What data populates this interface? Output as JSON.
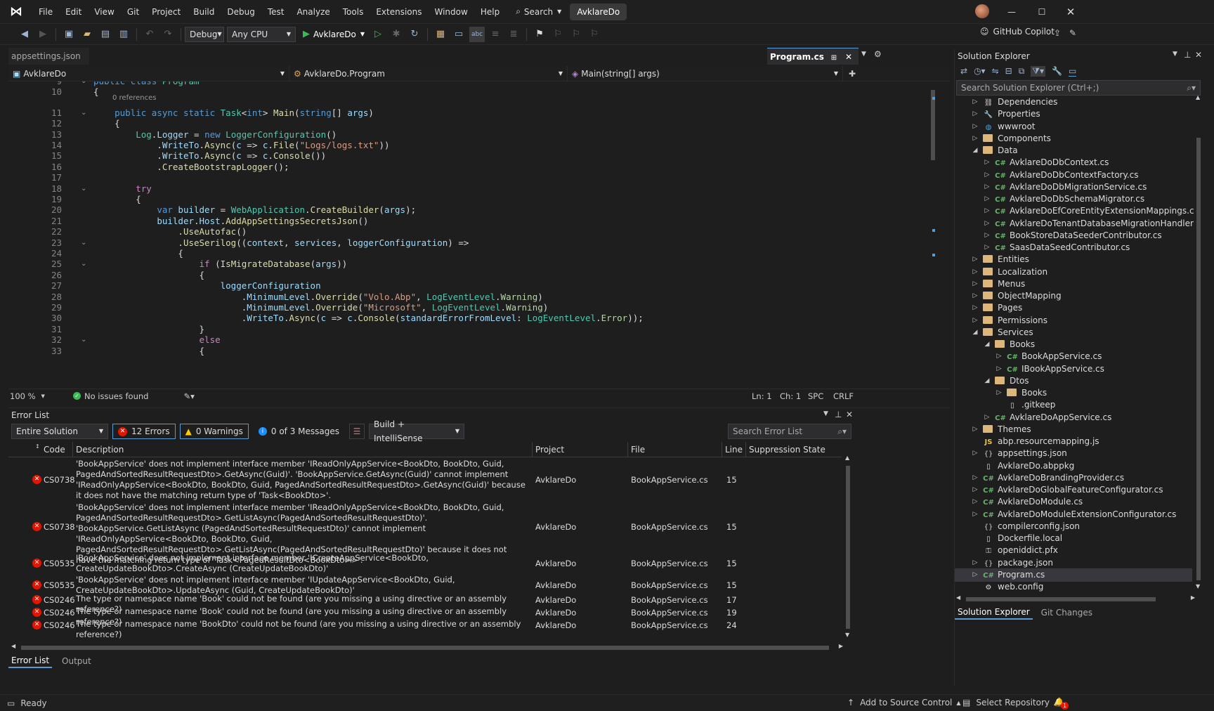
{
  "titlebar": {
    "menus": [
      "File",
      "Edit",
      "View",
      "Git",
      "Project",
      "Build",
      "Debug",
      "Test",
      "Analyze",
      "Tools",
      "Extensions",
      "Window",
      "Help"
    ],
    "search_label": "Search",
    "solution_name": "AvklareDo"
  },
  "toolbar": {
    "config": "Debug",
    "platform": "Any CPU",
    "run_target": "AvklareDo",
    "copilot_label": "GitHub Copilot"
  },
  "editor": {
    "preview_tab": "appsettings.json",
    "active_tab": "Program.cs",
    "nav_project": "AvklareDo",
    "nav_type": "AvklareDo.Program",
    "nav_member": "Main(string[] args)",
    "codelens": "0 references",
    "zoom": "100 %",
    "issues": "No issues found",
    "ln": "Ln: 1",
    "ch": "Ch: 1",
    "spc": "SPC",
    "eol": "CRLF",
    "lines": [
      {
        "n": "9",
        "html": "<span class='kw'>public</span> <span class='kw'>class</span> <span class='ty'>Program</span>"
      },
      {
        "n": "10",
        "html": "{"
      },
      {
        "n": "11",
        "html": "    <span class='kw'>public</span> <span class='kw'>async</span> <span class='kw'>static</span> <span class='ty'>Task</span>&lt;<span class='kw'>int</span>&gt; <span class='fn'>Main</span>(<span class='kw'>string</span>[] <span class='pa'>args</span>)"
      },
      {
        "n": "12",
        "html": "    {"
      },
      {
        "n": "13",
        "html": "        <span class='ty'>Log</span>.<span class='pa'>Logger</span> = <span class='kw'>new</span> <span class='ty'>LoggerConfiguration</span>()"
      },
      {
        "n": "14",
        "html": "            .<span class='pa'>WriteTo</span>.<span class='fn'>Async</span>(<span class='pa'>c</span> =&gt; <span class='pa'>c</span>.<span class='fn'>File</span>(<span class='st'>\"Logs/logs.txt\"</span>))"
      },
      {
        "n": "15",
        "html": "            .<span class='pa'>WriteTo</span>.<span class='fn'>Async</span>(<span class='pa'>c</span> =&gt; <span class='pa'>c</span>.<span class='fn'>Console</span>())"
      },
      {
        "n": "16",
        "html": "            .<span class='fn'>CreateBootstrapLogger</span>();"
      },
      {
        "n": "17",
        "html": ""
      },
      {
        "n": "18",
        "html": "        <span class='ct'>try</span>"
      },
      {
        "n": "19",
        "html": "        {"
      },
      {
        "n": "20",
        "html": "            <span class='kw'>var</span> <span class='pa'>builder</span> = <span class='ty'>WebApplication</span>.<span class='fn'>CreateBuilder</span>(<span class='pa'>args</span>);"
      },
      {
        "n": "21",
        "html": "            <span class='pa'>builder</span>.<span class='pa'>Host</span>.<span class='fn'>AddAppSettingsSecretsJson</span>()"
      },
      {
        "n": "22",
        "html": "                .<span class='fn'>UseAutofac</span>()"
      },
      {
        "n": "23",
        "html": "                .<span class='fn'>UseSerilog</span>((<span class='pa'>context</span>, <span class='pa'>services</span>, <span class='pa'>loggerConfiguration</span>) =&gt;"
      },
      {
        "n": "24",
        "html": "                {"
      },
      {
        "n": "25",
        "html": "                    <span class='ct'>if</span> (<span class='fn'>IsMigrateDatabase</span>(<span class='pa'>args</span>))"
      },
      {
        "n": "26",
        "html": "                    {"
      },
      {
        "n": "27",
        "html": "                        <span class='pa'>loggerConfiguration</span>"
      },
      {
        "n": "28",
        "html": "                            .<span class='pa'>MinimumLevel</span>.<span class='fn'>Override</span>(<span class='st'>\"Volo.Abp\"</span>, <span class='ty'>LogEventLevel</span>.<span class='en'>Warning</span>)"
      },
      {
        "n": "29",
        "html": "                            .<span class='pa'>MinimumLevel</span>.<span class='fn'>Override</span>(<span class='st'>\"Microsoft\"</span>, <span class='ty'>LogEventLevel</span>.<span class='en'>Warning</span>)"
      },
      {
        "n": "30",
        "html": "                            .<span class='pa'>WriteTo</span>.<span class='fn'>Async</span>(<span class='pa'>c</span> =&gt; <span class='pa'>c</span>.<span class='fn'>Console</span>(<span class='pa'>standardErrorFromLevel</span>: <span class='ty'>LogEventLevel</span>.<span class='en'>Error</span>));"
      },
      {
        "n": "31",
        "html": "                    }"
      },
      {
        "n": "32",
        "html": "                    <span class='ct'>else</span>"
      },
      {
        "n": "33",
        "html": "                    {"
      }
    ]
  },
  "errorlist": {
    "title": "Error List",
    "scope": "Entire Solution",
    "errors_btn": "12 Errors",
    "warnings_btn": "0 Warnings",
    "messages_btn": "0 of 3 Messages",
    "source": "Build + IntelliSense",
    "search_placeholder": "Search Error List",
    "columns": {
      "code": "Code",
      "description": "Description",
      "project": "Project",
      "file": "File",
      "line": "Line",
      "suppression": "Suppression State"
    },
    "rows": [
      {
        "code": "CS0738",
        "desc": "'BookAppService' does not implement interface member 'IReadOnlyAppService<BookDto, BookDto, Guid, PagedAndSortedResultRequestDto>.GetAsync(Guid)'. 'BookAppService.GetAsync(Guid)' cannot implement 'IReadOnlyAppService<BookDto, BookDto, Guid, PagedAndSortedResultRequestDto>.GetAsync(Guid)' because it does not have the matching return type of 'Task<BookDto>'.",
        "project": "AvklareDo",
        "file": "BookAppService.cs",
        "line": "15"
      },
      {
        "code": "CS0738",
        "desc": "'BookAppService' does not implement interface member 'IReadOnlyAppService<BookDto, BookDto, Guid, PagedAndSortedResultRequestDto>.GetListAsync(PagedAndSortedResultRequestDto)'. 'BookAppService.GetListAsync (PagedAndSortedResultRequestDto)' cannot implement 'IReadOnlyAppService<BookDto, BookDto, Guid, PagedAndSortedResultRequestDto>.GetListAsync(PagedAndSortedResultRequestDto)' because it does not have the matching return type of 'Task<PagedResultDto<BookDto>>'.",
        "project": "AvklareDo",
        "file": "BookAppService.cs",
        "line": "15"
      },
      {
        "code": "CS0535",
        "desc": "'BookAppService' does not implement interface member 'ICreateAppService<BookDto, CreateUpdateBookDto>.CreateAsync (CreateUpdateBookDto)'",
        "project": "AvklareDo",
        "file": "BookAppService.cs",
        "line": "15"
      },
      {
        "code": "CS0535",
        "desc": "'BookAppService' does not implement interface member 'IUpdateAppService<BookDto, Guid, CreateUpdateBookDto>.UpdateAsync (Guid, CreateUpdateBookDto)'",
        "project": "AvklareDo",
        "file": "BookAppService.cs",
        "line": "15"
      },
      {
        "code": "CS0246",
        "desc": "The type or namespace name 'Book' could not be found (are you missing a using directive or an assembly reference?)",
        "project": "AvklareDo",
        "file": "BookAppService.cs",
        "line": "17"
      },
      {
        "code": "CS0246",
        "desc": "The type or namespace name 'Book' could not be found (are you missing a using directive or an assembly reference?)",
        "project": "AvklareDo",
        "file": "BookAppService.cs",
        "line": "19"
      },
      {
        "code": "CS0246",
        "desc": "The type or namespace name 'BookDto' could not be found (are you missing a using directive or an assembly reference?)",
        "project": "AvklareDo",
        "file": "BookAppService.cs",
        "line": "24"
      }
    ],
    "bottom_tabs": [
      "Error List",
      "Output"
    ]
  },
  "solution_explorer": {
    "title": "Solution Explorer",
    "search_placeholder": "Search Solution Explorer (Ctrl+;)",
    "items": [
      {
        "label": "Dependencies",
        "depth": 0,
        "icon": "deps",
        "arrow": "right"
      },
      {
        "label": "Properties",
        "depth": 0,
        "icon": "wrench",
        "arrow": "right"
      },
      {
        "label": "wwwroot",
        "depth": 0,
        "icon": "globe",
        "arrow": "right"
      },
      {
        "label": "Components",
        "depth": 0,
        "icon": "folder",
        "arrow": "right"
      },
      {
        "label": "Data",
        "depth": 0,
        "icon": "folder",
        "arrow": "down"
      },
      {
        "label": "AvklareDoDbContext.cs",
        "depth": 1,
        "icon": "cs",
        "arrow": "right"
      },
      {
        "label": "AvklareDoDbContextFactory.cs",
        "depth": 1,
        "icon": "cs",
        "arrow": "right"
      },
      {
        "label": "AvklareDoDbMigrationService.cs",
        "depth": 1,
        "icon": "cs",
        "arrow": "right"
      },
      {
        "label": "AvklareDoDbSchemaMigrator.cs",
        "depth": 1,
        "icon": "cs",
        "arrow": "right"
      },
      {
        "label": "AvklareDoEfCoreEntityExtensionMappings.cs",
        "depth": 1,
        "icon": "cs",
        "arrow": "right"
      },
      {
        "label": "AvklareDoTenantDatabaseMigrationHandler.cs",
        "depth": 1,
        "icon": "cs",
        "arrow": "right"
      },
      {
        "label": "BookStoreDataSeederContributor.cs",
        "depth": 1,
        "icon": "cs",
        "arrow": "right"
      },
      {
        "label": "SaasDataSeedContributor.cs",
        "depth": 1,
        "icon": "cs",
        "arrow": "right"
      },
      {
        "label": "Entities",
        "depth": 0,
        "icon": "folder",
        "arrow": "right"
      },
      {
        "label": "Localization",
        "depth": 0,
        "icon": "folder",
        "arrow": "right"
      },
      {
        "label": "Menus",
        "depth": 0,
        "icon": "folder",
        "arrow": "right"
      },
      {
        "label": "ObjectMapping",
        "depth": 0,
        "icon": "folder",
        "arrow": "right"
      },
      {
        "label": "Pages",
        "depth": 0,
        "icon": "folder",
        "arrow": "right"
      },
      {
        "label": "Permissions",
        "depth": 0,
        "icon": "folder",
        "arrow": "right"
      },
      {
        "label": "Services",
        "depth": 0,
        "icon": "folder",
        "arrow": "down"
      },
      {
        "label": "Books",
        "depth": 1,
        "icon": "folder",
        "arrow": "down"
      },
      {
        "label": "BookAppService.cs",
        "depth": 2,
        "icon": "cs",
        "arrow": "right"
      },
      {
        "label": "IBookAppService.cs",
        "depth": 2,
        "icon": "cs",
        "arrow": "right"
      },
      {
        "label": "Dtos",
        "depth": 1,
        "icon": "folder",
        "arrow": "down"
      },
      {
        "label": "Books",
        "depth": 2,
        "icon": "folder",
        "arrow": "right"
      },
      {
        "label": ".gitkeep",
        "depth": 2,
        "icon": "file",
        "arrow": ""
      },
      {
        "label": "AvklareDoAppService.cs",
        "depth": 1,
        "icon": "cs",
        "arrow": "right"
      },
      {
        "label": "Themes",
        "depth": 0,
        "icon": "folder",
        "arrow": "right"
      },
      {
        "label": "abp.resourcemapping.js",
        "depth": 0,
        "icon": "js",
        "arrow": ""
      },
      {
        "label": "appsettings.json",
        "depth": 0,
        "icon": "json",
        "arrow": "right"
      },
      {
        "label": "AvklareDo.abppkg",
        "depth": 0,
        "icon": "file",
        "arrow": ""
      },
      {
        "label": "AvklareDoBrandingProvider.cs",
        "depth": 0,
        "icon": "cs",
        "arrow": "right"
      },
      {
        "label": "AvklareDoGlobalFeatureConfigurator.cs",
        "depth": 0,
        "icon": "cs",
        "arrow": "right"
      },
      {
        "label": "AvklareDoModule.cs",
        "depth": 0,
        "icon": "cs",
        "arrow": "right"
      },
      {
        "label": "AvklareDoModuleExtensionConfigurator.cs",
        "depth": 0,
        "icon": "cs",
        "arrow": "right"
      },
      {
        "label": "compilerconfig.json",
        "depth": 0,
        "icon": "json",
        "arrow": ""
      },
      {
        "label": "Dockerfile.local",
        "depth": 0,
        "icon": "file",
        "arrow": ""
      },
      {
        "label": "openiddict.pfx",
        "depth": 0,
        "icon": "cert",
        "arrow": ""
      },
      {
        "label": "package.json",
        "depth": 0,
        "icon": "json",
        "arrow": "right"
      },
      {
        "label": "Program.cs",
        "depth": 0,
        "icon": "cs",
        "arrow": "right",
        "selected": true
      },
      {
        "label": "web.config",
        "depth": 0,
        "icon": "config",
        "arrow": ""
      }
    ],
    "bottom_tabs": [
      "Solution Explorer",
      "Git Changes"
    ]
  },
  "statusbar": {
    "ready": "Ready",
    "source_control": "Add to Source Control",
    "repository": "Select Repository",
    "notifications": "1"
  },
  "colors": {
    "accent": "#569cd6",
    "error": "#e51400",
    "selected": "#37373d"
  }
}
